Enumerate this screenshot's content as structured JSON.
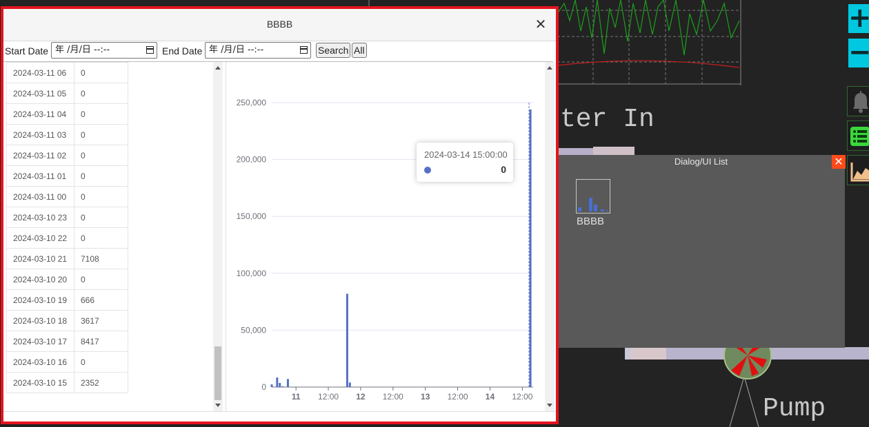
{
  "scada": {
    "label_water_in": "ter In",
    "label_pump": "Pump"
  },
  "side_tools": {
    "zoom_in": "+",
    "zoom_out": "−"
  },
  "ui_list": {
    "title": "Dialog/UI List",
    "close_label": "✕",
    "item_label": "BBBB"
  },
  "dialog": {
    "title": "BBBB",
    "close_label": "✕",
    "start_label": "Start Date",
    "start_value": "年 /月/日 --:--",
    "end_label": "End Date",
    "end_value": "年 /月/日 --:--",
    "search_label": "Search",
    "all_label": "All"
  },
  "table": {
    "rows": [
      {
        "time": "2024-03-11 06",
        "value": "0"
      },
      {
        "time": "2024-03-11 05",
        "value": "0"
      },
      {
        "time": "2024-03-11 04",
        "value": "0"
      },
      {
        "time": "2024-03-11 03",
        "value": "0"
      },
      {
        "time": "2024-03-11 02",
        "value": "0"
      },
      {
        "time": "2024-03-11 01",
        "value": "0"
      },
      {
        "time": "2024-03-11 00",
        "value": "0"
      },
      {
        "time": "2024-03-10 23",
        "value": "0"
      },
      {
        "time": "2024-03-10 22",
        "value": "0"
      },
      {
        "time": "2024-03-10 21",
        "value": "7108"
      },
      {
        "time": "2024-03-10 20",
        "value": "0"
      },
      {
        "time": "2024-03-10 19",
        "value": "666"
      },
      {
        "time": "2024-03-10 18",
        "value": "3617"
      },
      {
        "time": "2024-03-10 17",
        "value": "8417"
      },
      {
        "time": "2024-03-10 16",
        "value": "0"
      },
      {
        "time": "2024-03-10 15",
        "value": "2352"
      }
    ]
  },
  "tooltip": {
    "time": "2024-03-14 15:00:00",
    "value": "0"
  },
  "colors": {
    "series": "#5470c6",
    "dialog_border": "#e4141e",
    "accent_cyan": "#00c8e0",
    "close_orange": "#ff4a1a"
  },
  "chart_data": {
    "type": "bar",
    "ylim": [
      0,
      250000
    ],
    "yticks": [
      0,
      50000,
      100000,
      150000,
      200000,
      250000
    ],
    "ytick_labels": [
      "0",
      "50,000",
      "100,000",
      "150,000",
      "200,000",
      "250,000"
    ],
    "xtick_labels": [
      "11",
      "12:00",
      "12",
      "12:00",
      "13",
      "12:00",
      "14",
      "12:00"
    ],
    "xtick_bold": [
      true,
      false,
      true,
      false,
      true,
      false,
      true,
      false
    ],
    "xrange_hours": [
      0,
      97
    ],
    "xtick_hours": [
      9,
      21,
      33,
      45,
      57,
      69,
      81,
      93
    ],
    "series": [
      {
        "points": [
          {
            "h": 0,
            "value": 2352
          },
          {
            "h": 2,
            "value": 8417
          },
          {
            "h": 3,
            "value": 3617
          },
          {
            "h": 4,
            "value": 666
          },
          {
            "h": 6,
            "value": 7108
          },
          {
            "h": 28,
            "value": 82000
          },
          {
            "h": 29,
            "value": 4000
          },
          {
            "h": 96,
            "value": 244000
          }
        ]
      }
    ],
    "pointer_hour": 96
  }
}
